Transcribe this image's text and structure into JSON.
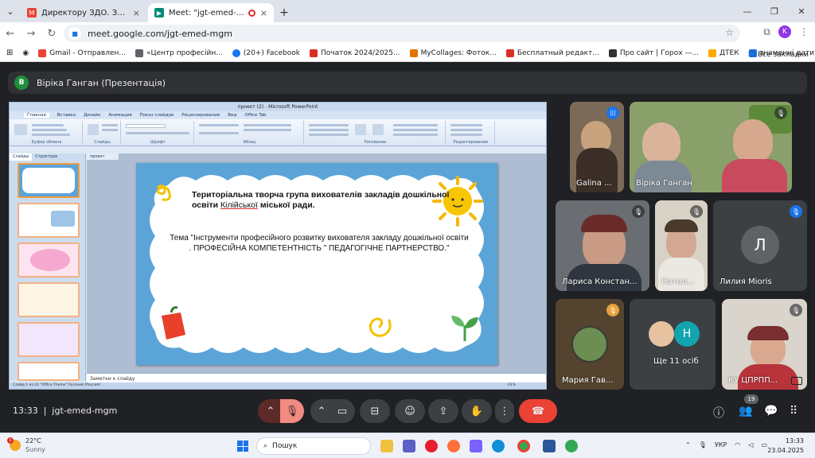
{
  "browser": {
    "tabs": [
      {
        "title": "Директору ЗДО. Запрошення",
        "active": false
      },
      {
        "title": "Meet: \"jgt-emed-mgm\"",
        "active": true
      }
    ],
    "url": "meet.google.com/jgt-emed-mgm",
    "profile_initial": "K",
    "bookmarks": [
      "Gmail - Отправлен...",
      "«Центр професійн...",
      "(20+) Facebook",
      "Початок 2024/2025...",
      "MyCollages: Фоток...",
      "Бесплатный редакт...",
      "Про сайт | Горох —...",
      "ДТЕК",
      "знаменні дати, пот..."
    ],
    "all_bookmarks": "Все закладки"
  },
  "meet": {
    "presenter_initial": "В",
    "presentation_title": "Віріка Ганган (Презентація)",
    "time": "13:33",
    "meeting_code": "jgt-emed-mgm",
    "participants_count": "19"
  },
  "ppt": {
    "window_title": "проект (2) - Microsoft PowerPoint",
    "ribbon_tabs": [
      "Главная",
      "Вставка",
      "Дизайн",
      "Анимация",
      "Показ слайдов",
      "Рецензирование",
      "Вид",
      "Office Tab"
    ],
    "ribbon_groups": [
      "Буфер обмена",
      "Слайды",
      "Шрифт",
      "Абзац",
      "Рисование",
      "Редактирование"
    ],
    "pane_tabs": [
      "Слайды",
      "Структура"
    ],
    "doc_tabs": [
      "проект",
      "проект (2)"
    ],
    "notes_placeholder": "Заметки к слайду",
    "status": "Слайд 1 из 22    \"Office Theme\"    Русский (Россия)",
    "zoom": "61%",
    "slide_line1": "Територіальна творча група    вихователів закладів дошкільної освіти",
    "slide_highlight": "Кілійської",
    "slide_line1_end": "міської ради.",
    "slide_line2": "Тема \"Інструменти професійного розвитку вихователя закладу дошкільної освіти . ПРОФЕСІЙНА КОМПЕТЕНТНІСТЬ \" ПЕДАГОГІЧНЕ ПАРТНЕРСТВО.\""
  },
  "participants": [
    {
      "name": "Galina ...",
      "state": "speaking"
    },
    {
      "name": "Віріка Ганган",
      "state": "muted"
    },
    {
      "name": "Лариса Констан...",
      "state": "muted"
    },
    {
      "name": "Натал...",
      "state": "muted"
    },
    {
      "name": "Лилия Miorіs",
      "initial": "Л",
      "state": "muted"
    },
    {
      "name": "Мария Гав...",
      "state": "muted"
    },
    {
      "name": "Ще 11 осіб",
      "initial": "Н"
    },
    {
      "name": "КУ ЦПРПП...",
      "state": "muted"
    }
  ],
  "taskbar": {
    "temperature": "22°C",
    "weather": "Sunny",
    "weather_badge": "1",
    "search_label": "Пошук",
    "lang": "УКР",
    "clock_time": "13:33",
    "clock_date": "23.04.2025"
  }
}
